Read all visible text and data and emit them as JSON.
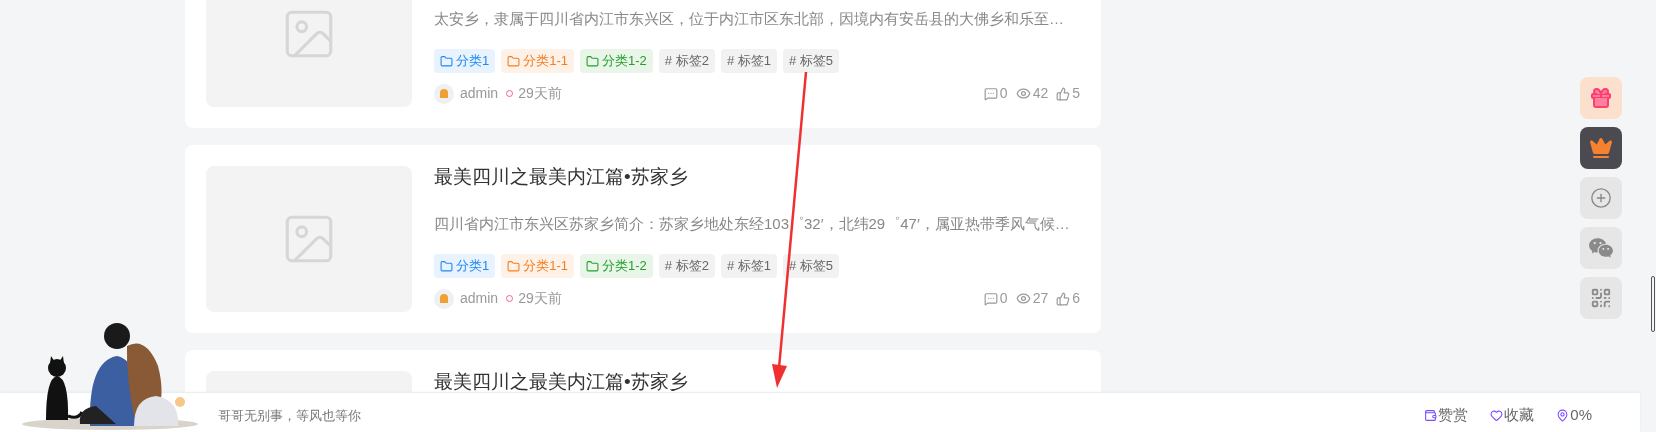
{
  "posts": [
    {
      "excerpt": "太安乡，隶属于四川省内江市东兴区，位于内江市区东北部，因境内有安岳县的大佛乡和乐至…",
      "tags": [
        {
          "kind": "category",
          "label": "分类1",
          "color": "#1e88f5"
        },
        {
          "kind": "category",
          "label": "分类1-1",
          "color": "#f57c1f"
        },
        {
          "kind": "category",
          "label": "分类1-2",
          "color": "#23a02c"
        },
        {
          "kind": "tag",
          "label": "# 标签2"
        },
        {
          "kind": "tag",
          "label": "# 标签1"
        },
        {
          "kind": "tag",
          "label": "# 标签5"
        }
      ],
      "author": "admin",
      "time": "29天前",
      "comments": "0",
      "views": "42",
      "likes": "5"
    },
    {
      "title": "最美四川之最美内江篇•苏家乡",
      "excerpt": "四川省内江市东兴区苏家乡简介：苏家乡地处东经103゜32′，北纬29゜47′，属亚热带季风气候…",
      "tags": [
        {
          "kind": "category",
          "label": "分类1",
          "color": "#1e88f5"
        },
        {
          "kind": "category",
          "label": "分类1-1",
          "color": "#f57c1f"
        },
        {
          "kind": "category",
          "label": "分类1-2",
          "color": "#23a02c"
        },
        {
          "kind": "tag",
          "label": "# 标签2"
        },
        {
          "kind": "tag",
          "label": "# 标签1"
        },
        {
          "kind": "tag",
          "label": "# 标签5"
        }
      ],
      "author": "admin",
      "time": "29天前",
      "comments": "0",
      "views": "27",
      "likes": "6"
    },
    {
      "title": "最美四川之最美内江篇•苏家乡"
    }
  ],
  "side_buttons": [
    {
      "kind": "gift"
    },
    {
      "kind": "crown"
    },
    {
      "kind": "plus"
    },
    {
      "kind": "wechat"
    },
    {
      "kind": "qrcode"
    }
  ],
  "footer": {
    "motto": "哥哥无别事，等风也等你",
    "actions": [
      {
        "kind": "reward",
        "label": "赞赏"
      },
      {
        "kind": "favorite",
        "label": "收藏"
      },
      {
        "kind": "progress",
        "label": "0%"
      }
    ]
  }
}
